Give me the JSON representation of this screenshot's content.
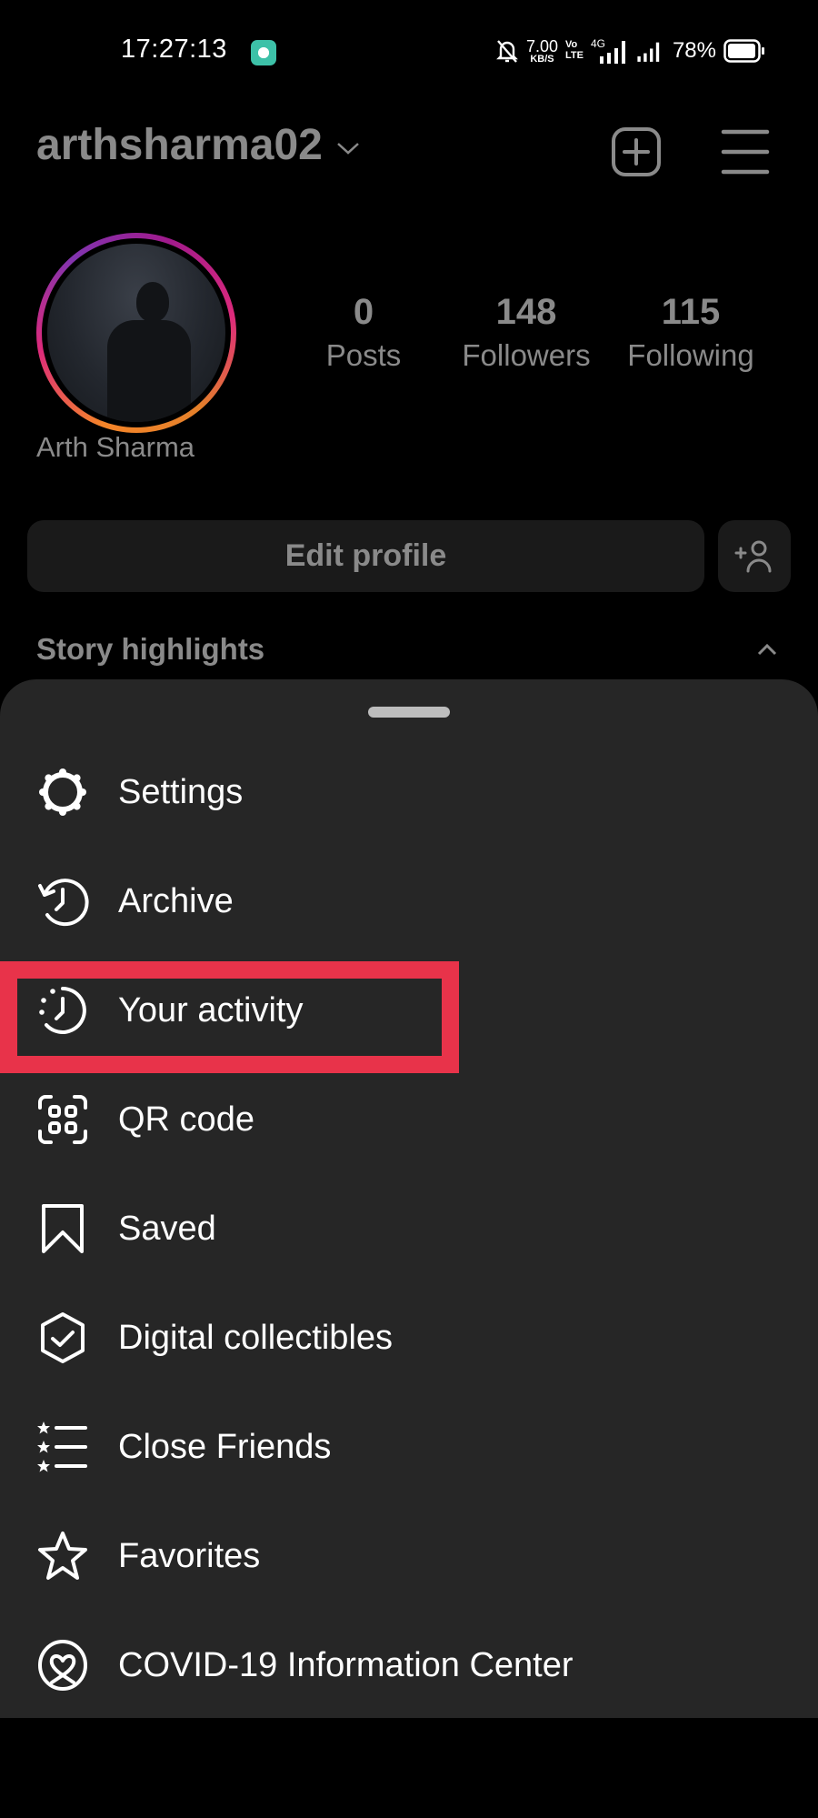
{
  "status_bar": {
    "time": "17:27:13",
    "net_speed_value": "7.00",
    "net_speed_unit": "KB/S",
    "volte_top": "Vo",
    "volte_bottom": "LTE",
    "network_type": "4G",
    "battery_percent": "78%",
    "icons": [
      "notification-app-icon",
      "bell-muted-icon",
      "signal-icon",
      "signal-icon",
      "battery-icon"
    ]
  },
  "header": {
    "username": "arthsharma02",
    "icons": [
      "chevron-down-icon",
      "add-post-icon",
      "hamburger-menu-icon"
    ]
  },
  "profile": {
    "full_name": "Arth Sharma",
    "stats": [
      {
        "value": "0",
        "label": "Posts"
      },
      {
        "value": "148",
        "label": "Followers"
      },
      {
        "value": "115",
        "label": "Following"
      }
    ],
    "edit_profile_label": "Edit profile",
    "story_highlights_label": "Story highlights"
  },
  "menu": {
    "items": [
      {
        "label": "Settings",
        "icon": "settings-gear-icon"
      },
      {
        "label": "Archive",
        "icon": "archive-history-icon"
      },
      {
        "label": "Your activity",
        "icon": "activity-clock-icon",
        "highlighted": true
      },
      {
        "label": "QR code",
        "icon": "qr-code-icon"
      },
      {
        "label": "Saved",
        "icon": "bookmark-icon"
      },
      {
        "label": "Digital collectibles",
        "icon": "hexagon-check-icon"
      },
      {
        "label": "Close Friends",
        "icon": "star-list-icon"
      },
      {
        "label": "Favorites",
        "icon": "star-icon"
      },
      {
        "label": "COVID-19 Information Center",
        "icon": "covid-heart-icon"
      }
    ]
  },
  "colors": {
    "background": "#000000",
    "sheet": "#262626",
    "dimmed_text": "#8a8a8a",
    "highlight_box": "#e8334a",
    "story_ring_start": "#f58529",
    "story_ring_end": "#8134af"
  }
}
